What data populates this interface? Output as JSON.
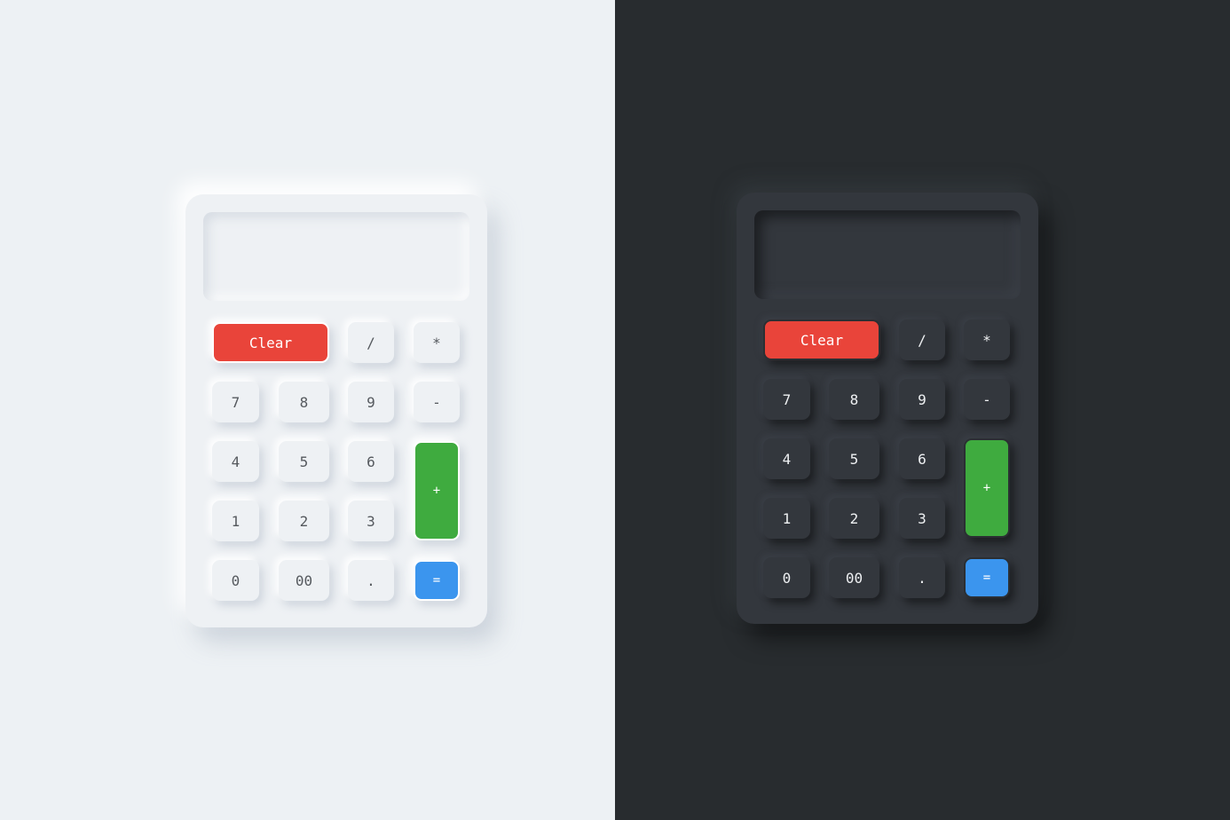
{
  "calculators": {
    "light": {
      "keys": {
        "clear": "Clear",
        "divide": "/",
        "multiply": "*",
        "seven": "7",
        "eight": "8",
        "nine": "9",
        "minus": "-",
        "four": "4",
        "five": "5",
        "six": "6",
        "plus": "+",
        "one": "1",
        "two": "2",
        "three": "3",
        "zero": "0",
        "double_zero": "00",
        "decimal": ".",
        "equals": "="
      }
    },
    "dark": {
      "keys": {
        "clear": "Clear",
        "divide": "/",
        "multiply": "*",
        "seven": "7",
        "eight": "8",
        "nine": "9",
        "minus": "-",
        "four": "4",
        "five": "5",
        "six": "6",
        "plus": "+",
        "one": "1",
        "two": "2",
        "three": "3",
        "zero": "0",
        "double_zero": "00",
        "decimal": ".",
        "equals": "="
      }
    }
  },
  "colors": {
    "light_background": "#edf1f4",
    "dark_background": "#282c2f",
    "clear_key": "#e9443a",
    "plus_key": "#3fab3f",
    "equals_key": "#3b95ee"
  }
}
